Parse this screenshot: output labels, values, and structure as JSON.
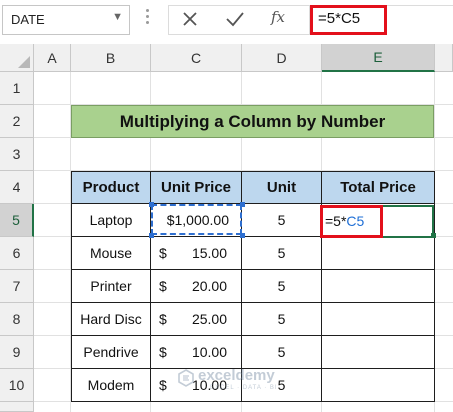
{
  "formula_bar": {
    "name_box": "DATE",
    "formula": "=5*C5",
    "fx_label": "fx"
  },
  "grid": {
    "columns": [
      "A",
      "B",
      "C",
      "D",
      "E"
    ],
    "active_column": "E",
    "rows": [
      "1",
      "2",
      "3",
      "4",
      "5",
      "6",
      "7",
      "8",
      "9",
      "10"
    ],
    "active_row": "5"
  },
  "sheet": {
    "title": "Multiplying a Column by Number",
    "headers": [
      "Product",
      "Unit Price",
      "Unit",
      "Total Price"
    ],
    "rows": [
      {
        "product": "Laptop",
        "currency": "",
        "price": "$1,000.00",
        "unit": "5"
      },
      {
        "product": "Mouse",
        "currency": "$",
        "price": "15.00",
        "unit": "5"
      },
      {
        "product": "Printer",
        "currency": "$",
        "price": "20.00",
        "unit": "5"
      },
      {
        "product": "Hard Disc",
        "currency": "$",
        "price": "25.00",
        "unit": "5"
      },
      {
        "product": "Pendrive",
        "currency": "$",
        "price": "10.00",
        "unit": "5"
      },
      {
        "product": "Modem",
        "currency": "$",
        "price": "10.00",
        "unit": "5"
      }
    ],
    "edit_cell": {
      "prefix": "=5*",
      "ref": "C5"
    }
  },
  "watermark": {
    "name": "exceldemy",
    "tagline": "EXCEL · DATA · BI"
  },
  "colors": {
    "title_bg": "#a9d18e",
    "header_bg": "#bdd7ee",
    "highlight_red": "#e3101b",
    "ref_blue": "#1f6fd6",
    "excel_green": "#217346"
  }
}
